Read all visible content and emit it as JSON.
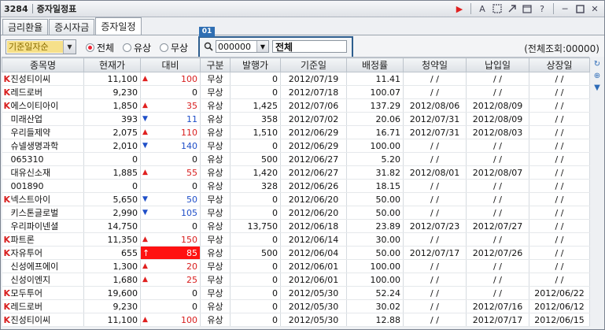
{
  "window": {
    "code": "3284",
    "title": "증자일정표"
  },
  "titlebar_icons": [
    "play-icon",
    "font-icon",
    "capture-icon",
    "link-icon",
    "window-icon",
    "help-icon",
    "minimize-icon",
    "maximize-icon",
    "close-icon"
  ],
  "tabs": [
    {
      "label": "금리환율",
      "active": false
    },
    {
      "label": "증시자금",
      "active": false
    },
    {
      "label": "증자일정",
      "active": true
    }
  ],
  "filter": {
    "sort_select": "기준일자순",
    "radios": [
      {
        "label": "전체",
        "checked": true
      },
      {
        "label": "유상",
        "checked": false
      },
      {
        "label": "무상",
        "checked": false
      }
    ],
    "badge": "01",
    "code_value": "000000",
    "name_value": "전체",
    "total_label": "(전체조회:00000)"
  },
  "table": {
    "columns": [
      "종목명",
      "현재가",
      "대비",
      "구분",
      "발행가",
      "기준일",
      "배정률",
      "청약일",
      "납입일",
      "상장일"
    ],
    "rows": [
      {
        "k": true,
        "name": "진성티이씨",
        "price": "11,100",
        "dir": "up",
        "chg": "100",
        "type": "무상",
        "issue": "0",
        "base": "2012/07/19",
        "ratio": "11.41",
        "sub": "/ /",
        "pay": "/ /",
        "list": "/ /"
      },
      {
        "k": true,
        "name": "레드로버",
        "price": "9,230",
        "dir": "",
        "chg": "0",
        "type": "무상",
        "issue": "0",
        "base": "2012/07/18",
        "ratio": "100.07",
        "sub": "/ /",
        "pay": "/ /",
        "list": "/ /"
      },
      {
        "k": true,
        "name": "에스이티아이",
        "price": "1,850",
        "dir": "up",
        "chg": "35",
        "type": "유상",
        "issue": "1,425",
        "base": "2012/07/06",
        "ratio": "137.29",
        "sub": "2012/08/06",
        "pay": "2012/08/09",
        "list": "/ /"
      },
      {
        "k": false,
        "name": "미래산업",
        "price": "393",
        "dir": "dn",
        "chg": "11",
        "type": "유상",
        "issue": "358",
        "base": "2012/07/02",
        "ratio": "20.06",
        "sub": "2012/07/31",
        "pay": "2012/08/09",
        "list": "/ /"
      },
      {
        "k": false,
        "name": "우리들제약",
        "price": "2,075",
        "dir": "up",
        "chg": "110",
        "type": "유상",
        "issue": "1,510",
        "base": "2012/06/29",
        "ratio": "16.71",
        "sub": "2012/07/31",
        "pay": "2012/08/03",
        "list": "/ /"
      },
      {
        "k": false,
        "name": "슈넬생명과학",
        "price": "2,010",
        "dir": "dn",
        "chg": "140",
        "type": "무상",
        "issue": "0",
        "base": "2012/06/29",
        "ratio": "100.00",
        "sub": "/ /",
        "pay": "/ /",
        "list": "/ /"
      },
      {
        "k": false,
        "name": "065310",
        "price": "0",
        "dir": "",
        "chg": "0",
        "type": "유상",
        "issue": "500",
        "base": "2012/06/27",
        "ratio": "5.20",
        "sub": "/ /",
        "pay": "/ /",
        "list": "/ /"
      },
      {
        "k": false,
        "name": "대유신소재",
        "price": "1,885",
        "dir": "up",
        "chg": "55",
        "type": "유상",
        "issue": "1,420",
        "base": "2012/06/27",
        "ratio": "31.82",
        "sub": "2012/08/01",
        "pay": "2012/08/07",
        "list": "/ /"
      },
      {
        "k": false,
        "name": "001890",
        "price": "0",
        "dir": "",
        "chg": "0",
        "type": "유상",
        "issue": "328",
        "base": "2012/06/26",
        "ratio": "18.15",
        "sub": "/ /",
        "pay": "/ /",
        "list": "/ /"
      },
      {
        "k": true,
        "name": "넥스트아이",
        "price": "5,650",
        "dir": "dn",
        "chg": "50",
        "type": "무상",
        "issue": "0",
        "base": "2012/06/20",
        "ratio": "50.00",
        "sub": "/ /",
        "pay": "/ /",
        "list": "/ /"
      },
      {
        "k": false,
        "name": "키스톤글로벌",
        "price": "2,990",
        "dir": "dn",
        "chg": "105",
        "type": "무상",
        "issue": "0",
        "base": "2012/06/20",
        "ratio": "50.00",
        "sub": "/ /",
        "pay": "/ /",
        "list": "/ /"
      },
      {
        "k": false,
        "name": "우리파이넨셜",
        "price": "14,750",
        "dir": "",
        "chg": "0",
        "type": "유상",
        "issue": "13,750",
        "base": "2012/06/18",
        "ratio": "23.89",
        "sub": "2012/07/23",
        "pay": "2012/07/27",
        "list": "/ /"
      },
      {
        "k": true,
        "name": "파트론",
        "price": "11,350",
        "dir": "up",
        "chg": "150",
        "type": "무상",
        "issue": "0",
        "base": "2012/06/14",
        "ratio": "30.00",
        "sub": "/ /",
        "pay": "/ /",
        "list": "/ /"
      },
      {
        "k": true,
        "name": "자유투어",
        "price": "655",
        "dir": "limitup",
        "chg": "85",
        "type": "유상",
        "issue": "500",
        "base": "2012/06/04",
        "ratio": "50.00",
        "sub": "2012/07/17",
        "pay": "2012/07/26",
        "list": "/ /"
      },
      {
        "k": false,
        "name": "신성에프에이",
        "price": "1,300",
        "dir": "up",
        "chg": "20",
        "type": "무상",
        "issue": "0",
        "base": "2012/06/01",
        "ratio": "100.00",
        "sub": "/ /",
        "pay": "/ /",
        "list": "/ /"
      },
      {
        "k": false,
        "name": "신성이엔지",
        "price": "1,680",
        "dir": "up",
        "chg": "25",
        "type": "무상",
        "issue": "0",
        "base": "2012/06/01",
        "ratio": "100.00",
        "sub": "/ /",
        "pay": "/ /",
        "list": "/ /"
      },
      {
        "k": true,
        "name": "모두투어",
        "price": "19,600",
        "dir": "",
        "chg": "0",
        "type": "무상",
        "issue": "0",
        "base": "2012/05/30",
        "ratio": "52.24",
        "sub": "/ /",
        "pay": "/ /",
        "list": "2012/06/22"
      },
      {
        "k": true,
        "name": "레드로버",
        "price": "9,230",
        "dir": "",
        "chg": "0",
        "type": "유상",
        "issue": "0",
        "base": "2012/05/30",
        "ratio": "30.02",
        "sub": "/ /",
        "pay": "2012/07/16",
        "list": "2012/06/12"
      },
      {
        "k": true,
        "name": "진성티이씨",
        "price": "11,100",
        "dir": "up",
        "chg": "100",
        "type": "유상",
        "issue": "0",
        "base": "2012/05/30",
        "ratio": "12.88",
        "sub": "/ /",
        "pay": "2012/07/17",
        "list": "2012/06/15"
      }
    ]
  },
  "sidebar_icons": [
    "refresh-icon",
    "add-icon",
    "download-icon"
  ]
}
